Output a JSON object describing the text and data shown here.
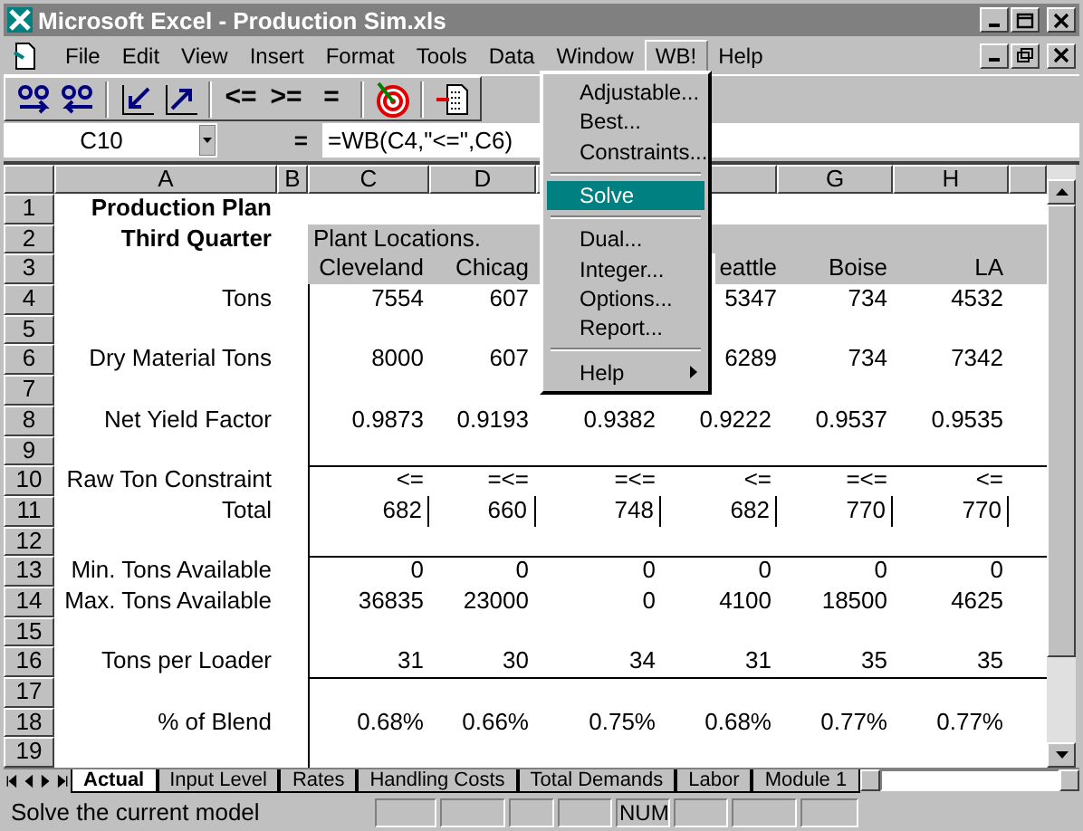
{
  "window": {
    "title": "Microsoft Excel - Production Sim.xls"
  },
  "menu_bar": [
    {
      "label": "File",
      "selected": false
    },
    {
      "label": "Edit",
      "selected": false
    },
    {
      "label": "View",
      "selected": false
    },
    {
      "label": "Insert",
      "selected": false
    },
    {
      "label": "Format",
      "selected": false
    },
    {
      "label": "Tools",
      "selected": false
    },
    {
      "label": "Data",
      "selected": false
    },
    {
      "label": "Window",
      "selected": false
    },
    {
      "label": "WB!",
      "selected": true
    },
    {
      "label": "Help",
      "selected": false
    }
  ],
  "toolbar_text_buttons": [
    "<=",
    ">=",
    "="
  ],
  "formula_bar": {
    "name_box": "C10",
    "equals": "=",
    "formula": "=WB(C4,\"<=\",C6)"
  },
  "columns": [
    {
      "label": "A"
    },
    {
      "label": "B"
    },
    {
      "label": "C"
    },
    {
      "label": "D"
    },
    {},
    {},
    {
      "label": "G"
    },
    {
      "label": "H"
    },
    {}
  ],
  "rows": [
    {
      "number": "1",
      "kind": "title",
      "cells": [
        "Production Plan"
      ]
    },
    {
      "number": "2",
      "kind": "heading",
      "cells": [
        "Third Quarter",
        null,
        "Plant Locations."
      ]
    },
    {
      "number": "3",
      "kind": "header",
      "cells": [
        null,
        null,
        "Cleveland",
        "Chicag",
        null,
        "eattle",
        "Boise",
        "LA"
      ]
    },
    {
      "number": "4",
      "kind": "data",
      "cells": [
        "Tons",
        null,
        "7554",
        "607",
        null,
        "5347",
        "734",
        "4532"
      ]
    },
    {
      "number": "5",
      "kind": "data",
      "cells": []
    },
    {
      "number": "6",
      "kind": "data",
      "cells": [
        "Dry Material Tons",
        null,
        "8000",
        "607",
        null,
        "6289",
        "734",
        "7342"
      ]
    },
    {
      "number": "7",
      "kind": "data",
      "cells": []
    },
    {
      "number": "8",
      "kind": "data",
      "cells": [
        "Net Yield Factor",
        null,
        "0.9873",
        "0.9193",
        "0.9382",
        "0.9222",
        "0.9537",
        "0.9535"
      ]
    },
    {
      "number": "9",
      "kind": "data",
      "cells": []
    },
    {
      "number": "10",
      "kind": "data",
      "rule_above": true,
      "cells": [
        "Raw Ton Constraint",
        null,
        "<=",
        "=<=",
        "=<=",
        "<=",
        "=<=",
        "<="
      ]
    },
    {
      "number": "11",
      "kind": "total",
      "cells": [
        "Total",
        null,
        "682",
        "660",
        "748",
        "682",
        "770",
        "770"
      ]
    },
    {
      "number": "12",
      "kind": "data",
      "cells": []
    },
    {
      "number": "13",
      "kind": "data",
      "rule_above": true,
      "cells": [
        "Min. Tons Available",
        null,
        "0",
        "0",
        "0",
        "0",
        "0",
        "0"
      ]
    },
    {
      "number": "14",
      "kind": "data",
      "cells": [
        "Max. Tons Available",
        null,
        "36835",
        "23000",
        "0",
        "4100",
        "18500",
        "4625"
      ]
    },
    {
      "number": "15",
      "kind": "data",
      "cells": []
    },
    {
      "number": "16",
      "kind": "data",
      "cells": [
        "Tons per Loader",
        null,
        "31",
        "30",
        "34",
        "31",
        "35",
        "35"
      ]
    },
    {
      "number": "17",
      "kind": "data",
      "rule_above": true,
      "cells": []
    },
    {
      "number": "18",
      "kind": "data",
      "cells": [
        "% of Blend",
        null,
        "0.68%",
        "0.66%",
        "0.75%",
        "0.68%",
        "0.77%",
        "0.77%"
      ]
    },
    {
      "number": "19",
      "kind": "data",
      "cells": []
    }
  ],
  "sheet_tabs": [
    {
      "label": "Actual",
      "selected": true
    },
    {
      "label": "Input Level",
      "selected": false
    },
    {
      "label": "Rates",
      "selected": false
    },
    {
      "label": "Handling Costs",
      "selected": false
    },
    {
      "label": "Total Demands",
      "selected": false
    },
    {
      "label": "Labor",
      "selected": false
    },
    {
      "label": "Module 1",
      "selected": false
    }
  ],
  "dropdown_menu": [
    {
      "kind": "item",
      "label": "Adjustable...",
      "selected": false
    },
    {
      "kind": "item",
      "label": "Best...",
      "selected": false
    },
    {
      "kind": "item",
      "label": "Constraints...",
      "selected": false
    },
    {
      "kind": "separator"
    },
    {
      "kind": "item",
      "label": "Solve",
      "selected": true
    },
    {
      "kind": "separator"
    },
    {
      "kind": "item",
      "label": "Dual...",
      "selected": false
    },
    {
      "kind": "item",
      "label": "Integer...",
      "selected": false
    },
    {
      "kind": "item",
      "label": "Options...",
      "selected": false
    },
    {
      "kind": "item",
      "label": "Report...",
      "selected": false
    },
    {
      "kind": "separator"
    },
    {
      "kind": "submenu",
      "label": "Help",
      "selected": false
    }
  ],
  "status_bar": {
    "message": "Solve the current model",
    "indicator": "NUM"
  }
}
